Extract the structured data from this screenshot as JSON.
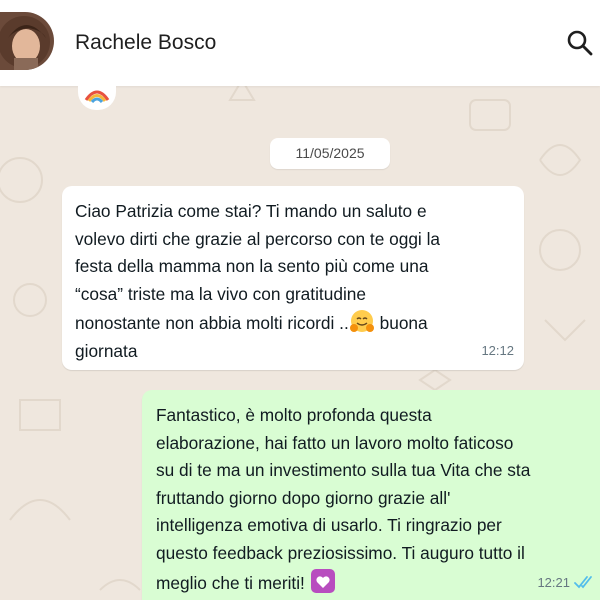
{
  "header": {
    "contact_name": "Rachele Bosco",
    "avatar_icon": "avatar",
    "search_icon": "search-icon"
  },
  "conversation": {
    "date_separator": "11/05/2025",
    "messages": [
      {
        "direction": "incoming",
        "text_before_emoji": "Ciao Patrizia come stai? Ti mando un saluto e\nvolevo dirti che grazie al percorso con te oggi la\nfesta della mamma non la sento più come una\n“cosa” triste ma la vivo con gratitudine\nnonostante non abbia molti ricordi ..",
        "emoji_icon": "hugging-face-icon",
        "text_after_emoji": " buona\ngiornata",
        "time": "12:12"
      },
      {
        "direction": "outgoing",
        "text_before_emoji": "Fantastico, è molto profonda questa\nelaborazione, hai fatto un lavoro molto faticoso\nsu di te ma un investimento sulla tua Vita che sta\nfruttando giorno dopo giorno grazie all'\nintelligenza emotiva di usarlo. Ti ringrazio per\nquesto feedback preziosissimo. Ti auguro tutto il\nmeglio che ti meriti! ",
        "emoji_icon": "heart-decoration-icon",
        "time": "12:21",
        "status_icon": "double-check-read-icon"
      }
    ]
  },
  "colors": {
    "wallpaper": "#efe7de",
    "incoming_bubble": "#ffffff",
    "outgoing_bubble": "#d9fdd3",
    "read_ticks": "#53bdeb",
    "text": "#111b21",
    "meta_text": "#667781"
  }
}
